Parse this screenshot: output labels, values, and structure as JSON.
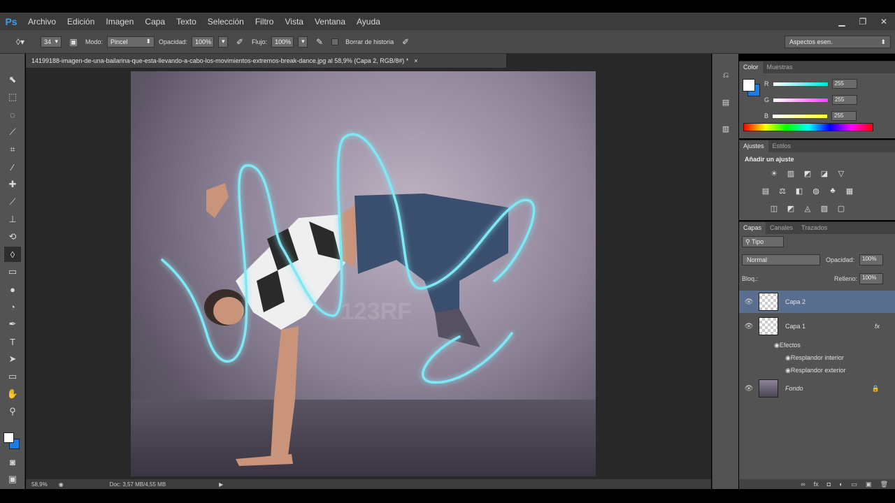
{
  "app": {
    "logo": "Ps"
  },
  "menu": [
    "Archivo",
    "Edición",
    "Imagen",
    "Capa",
    "Texto",
    "Selección",
    "Filtro",
    "Vista",
    "Ventana",
    "Ayuda"
  ],
  "window_controls": {
    "minimize": "▁",
    "restore": "❐",
    "close": "✕"
  },
  "options_bar": {
    "brush_size": "34",
    "modo_label": "Modo:",
    "modo_value": "Pincel",
    "opacidad_label": "Opacidad:",
    "opacidad_value": "100%",
    "flujo_label": "Flujo:",
    "flujo_value": "100%",
    "borrar_historia": "Borrar de historia",
    "workspace": "Aspectos esen."
  },
  "document": {
    "tab_title": "14199188-imagen-de-una-bailarina-que-esta-llevando-a-cabo-los-movimientos-extremos-break-dance.jpg al 58,9% (Capa 2, RGB/8#) *",
    "tab_close": "×",
    "watermark": "123RF",
    "zoom": "58,9%",
    "doc_size": "Doc: 3,57 MB/4,55 MB"
  },
  "color_panel": {
    "tabs": [
      "Color",
      "Muestras"
    ],
    "channels": [
      {
        "name": "R",
        "value": "255",
        "color": "#00e0e0"
      },
      {
        "name": "G",
        "value": "255",
        "color": "#ff40ff"
      },
      {
        "name": "B",
        "value": "255",
        "color": "#ffff30"
      }
    ],
    "foreground": "#ffffff",
    "background": "#1e7be0"
  },
  "adjustments_panel": {
    "tabs": [
      "Ajustes",
      "Estilos"
    ],
    "heading": "Añadir un ajuste",
    "row1": [
      "☀",
      "▥",
      "◩",
      "◪",
      "▽"
    ],
    "row2": [
      "▤",
      "⚖",
      "◧",
      "◍",
      "♣",
      "▦"
    ],
    "row3": [
      "◫",
      "◩",
      "◬",
      "▧",
      "▢"
    ]
  },
  "layers_panel": {
    "tabs": [
      "Capas",
      "Canales",
      "Trazados"
    ],
    "filter_kind": "Tipo",
    "blend_mode": "Normal",
    "opacity_label": "Opacidad:",
    "opacity_value": "100%",
    "lock_label": "Bloq.:",
    "fill_label": "Relleno:",
    "fill_value": "100%",
    "layers": [
      {
        "name": "Capa 2"
      },
      {
        "name": "Capa 1",
        "fx": "fx"
      },
      {
        "name": "Fondo"
      }
    ],
    "effects_label": "Efectos",
    "effects": [
      "Resplandor interior",
      "Resplandor exterior"
    ]
  }
}
